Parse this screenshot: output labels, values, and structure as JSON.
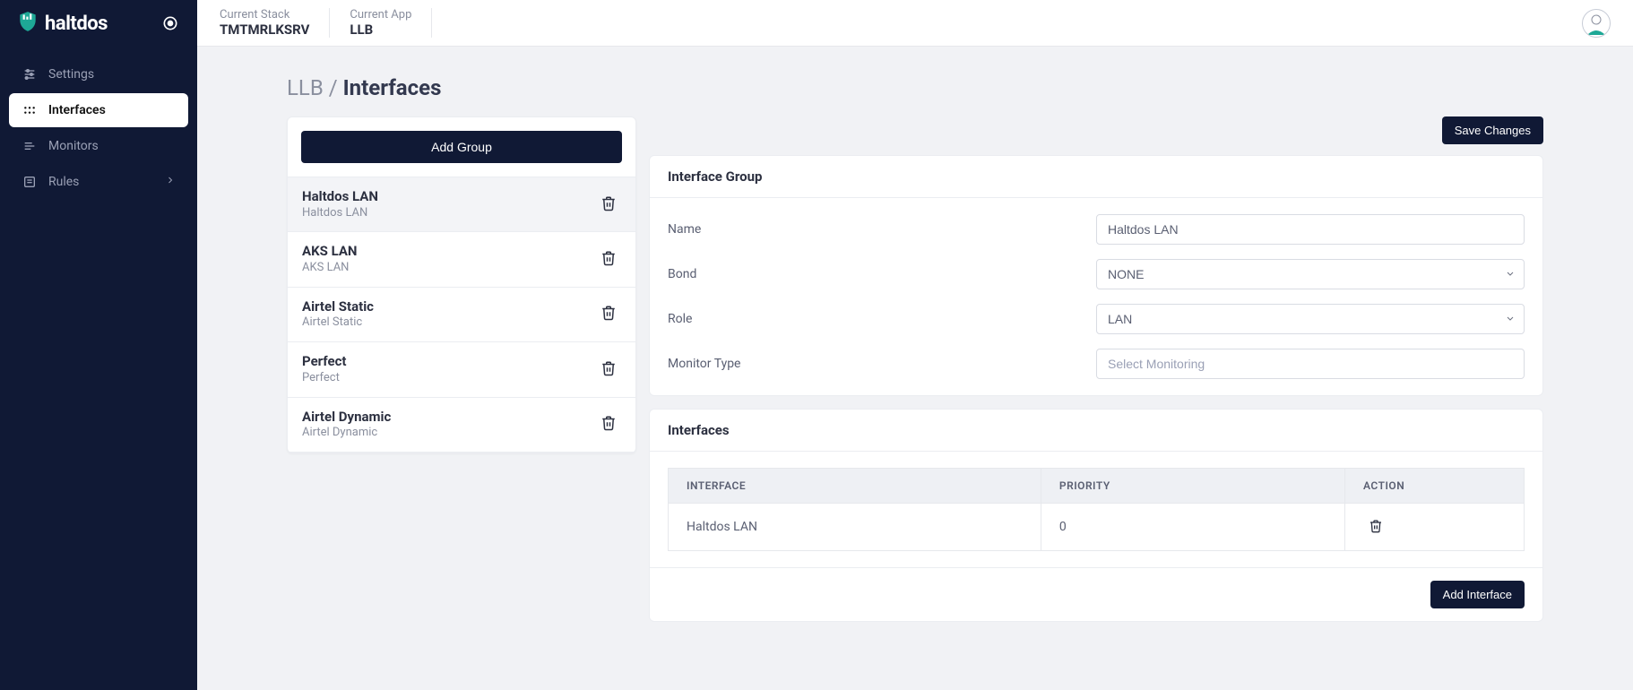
{
  "brand": "haltdos",
  "topbar": {
    "stack_label": "Current Stack",
    "stack_value": "TMTMRLKSRV",
    "app_label": "Current App",
    "app_value": "LLB"
  },
  "sidebar": {
    "items": [
      {
        "label": "Settings",
        "icon": "sliders-icon",
        "active": false
      },
      {
        "label": "Interfaces",
        "icon": "grid-icon",
        "active": true
      },
      {
        "label": "Monitors",
        "icon": "monitors-icon",
        "active": false
      },
      {
        "label": "Rules",
        "icon": "rules-icon",
        "active": false,
        "chevron": true
      }
    ]
  },
  "breadcrumb": {
    "prev": "LLB",
    "sep": "/",
    "current": "Interfaces"
  },
  "group_panel": {
    "add_button": "Add Group",
    "items": [
      {
        "title": "Haltdos LAN",
        "sub": "Haltdos LAN",
        "active": true
      },
      {
        "title": "AKS LAN",
        "sub": "AKS LAN",
        "active": false
      },
      {
        "title": "Airtel Static",
        "sub": "Airtel Static",
        "active": false
      },
      {
        "title": "Perfect",
        "sub": "Perfect",
        "active": false
      },
      {
        "title": "Airtel Dynamic",
        "sub": "Airtel Dynamic",
        "active": false
      }
    ]
  },
  "save_button": "Save Changes",
  "interface_group": {
    "title": "Interface Group",
    "fields": {
      "name_label": "Name",
      "name_value": "Haltdos LAN",
      "bond_label": "Bond",
      "bond_value": "NONE",
      "role_label": "Role",
      "role_value": "LAN",
      "monitor_label": "Monitor Type",
      "monitor_placeholder": "Select Monitoring"
    }
  },
  "interfaces_table": {
    "title": "Interfaces",
    "headers": {
      "interface": "INTERFACE",
      "priority": "PRIORITY",
      "action": "ACTION"
    },
    "rows": [
      {
        "interface": "Haltdos LAN",
        "priority": "0"
      }
    ],
    "add_button": "Add Interface"
  }
}
